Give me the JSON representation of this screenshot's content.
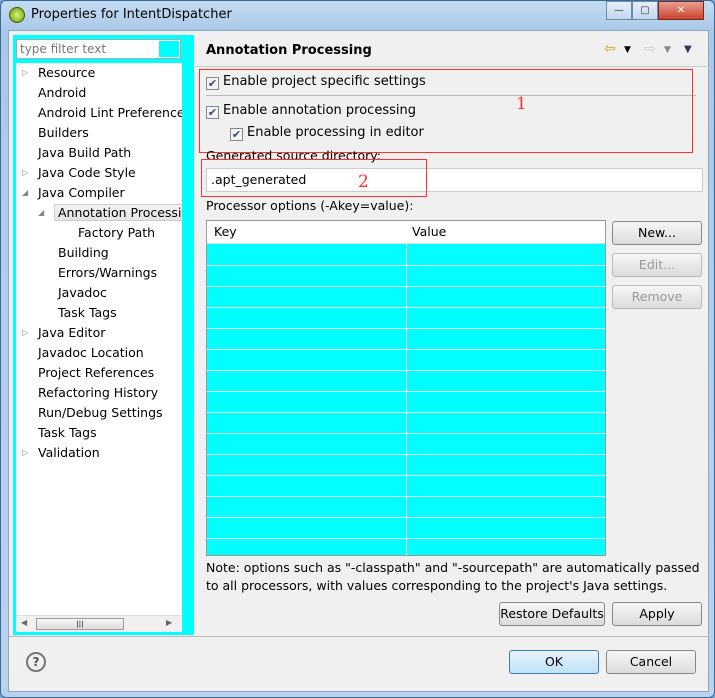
{
  "window": {
    "title": "Properties for IntentDispatcher",
    "controls": [
      "minimize",
      "maximize",
      "close"
    ]
  },
  "sidebar": {
    "filter_placeholder": "type filter text",
    "items": [
      {
        "label": "Resource",
        "level": 0,
        "expander": "collapsed"
      },
      {
        "label": "Android",
        "level": 0
      },
      {
        "label": "Android Lint Preferences",
        "level": 0
      },
      {
        "label": "Builders",
        "level": 0
      },
      {
        "label": "Java Build Path",
        "level": 0
      },
      {
        "label": "Java Code Style",
        "level": 0,
        "expander": "collapsed"
      },
      {
        "label": "Java Compiler",
        "level": 0,
        "expander": "expanded"
      },
      {
        "label": "Annotation Processing",
        "level": 1,
        "expander": "expanded",
        "selected": true
      },
      {
        "label": "Factory Path",
        "level": 2
      },
      {
        "label": "Building",
        "level": 1
      },
      {
        "label": "Errors/Warnings",
        "level": 1
      },
      {
        "label": "Javadoc",
        "level": 1
      },
      {
        "label": "Task Tags",
        "level": 1
      },
      {
        "label": "Java Editor",
        "level": 0,
        "expander": "collapsed"
      },
      {
        "label": "Javadoc Location",
        "level": 0
      },
      {
        "label": "Project References",
        "level": 0
      },
      {
        "label": "Refactoring History",
        "level": 0
      },
      {
        "label": "Run/Debug Settings",
        "level": 0
      },
      {
        "label": "Task Tags",
        "level": 0
      },
      {
        "label": "Validation",
        "level": 0,
        "expander": "collapsed"
      }
    ]
  },
  "main": {
    "title": "Annotation Processing",
    "enable_project_specific": {
      "label": "Enable project specific settings",
      "checked": true
    },
    "enable_annotation_processing": {
      "label": "Enable annotation processing",
      "checked": true
    },
    "enable_processing_in_editor": {
      "label": "Enable processing in editor",
      "checked": true
    },
    "annotation_1": "1",
    "annotation_2": "2",
    "gen_dir_label": "Generated source directory:",
    "gen_dir_value": ".apt_generated",
    "options_label": "Processor options (-Akey=value):",
    "table": {
      "columns": [
        "Key",
        "Value"
      ],
      "rows": []
    },
    "buttons": {
      "new": "New...",
      "edit": "Edit...",
      "remove": "Remove"
    },
    "note": "Note: options such as \"-classpath\" and \"-sourcepath\" are automatically passed to all processors, with values corresponding to the project's Java settings.",
    "restore_defaults": "Restore Defaults",
    "apply": "Apply"
  },
  "footer": {
    "ok": "OK",
    "cancel": "Cancel"
  },
  "colors": {
    "highlight": "#00ffff",
    "annotation": "#ff3030"
  }
}
